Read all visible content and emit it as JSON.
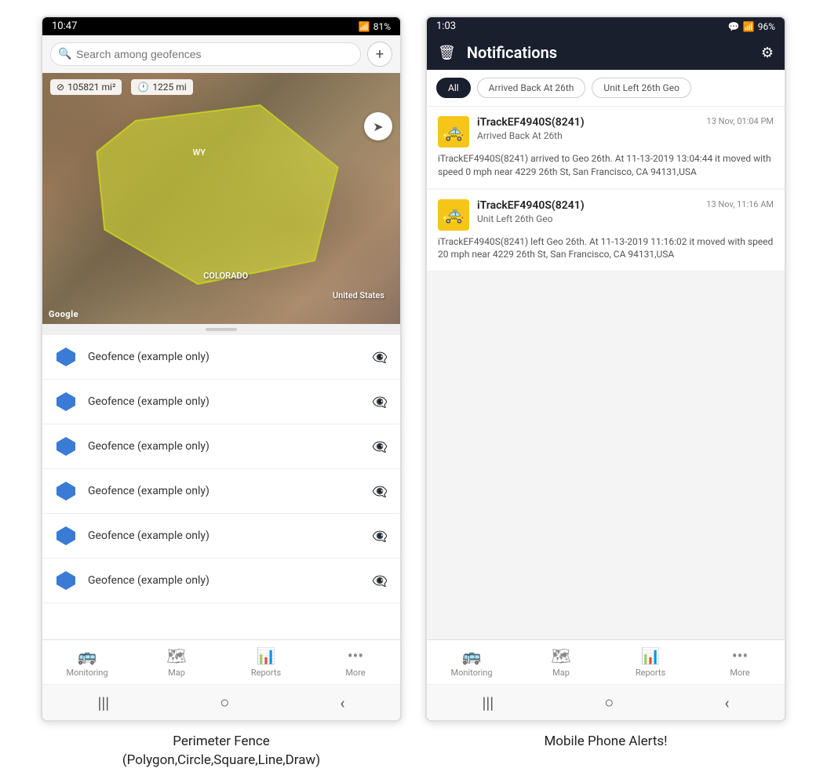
{
  "left_phone": {
    "status_bar": {
      "time": "10:47",
      "wifi": "📶",
      "signal": "📶",
      "battery": "81%"
    },
    "search_placeholder": "Search among geofences",
    "map": {
      "area_badge": "105821 mi²",
      "distance_badge": "1225 mi",
      "labels": {
        "wy": "WY",
        "colorado": "COLORADO",
        "united_states": "United States"
      },
      "google_label": "Google"
    },
    "geofences": [
      {
        "label": "Geofence (example only)"
      },
      {
        "label": "Geofence (example only)"
      },
      {
        "label": "Geofence (example only)"
      },
      {
        "label": "Geofence (example only)"
      },
      {
        "label": "Geofence (example only)"
      },
      {
        "label": "Geofence (example only)"
      }
    ],
    "bottom_nav": [
      {
        "label": "Monitoring",
        "icon": "🚌"
      },
      {
        "label": "Map",
        "icon": "🗺"
      },
      {
        "label": "Reports",
        "icon": "📊"
      },
      {
        "label": "More",
        "icon": "···"
      }
    ]
  },
  "right_phone": {
    "status_bar": {
      "time": "1:03",
      "chat_icon": "💬",
      "battery": "96%"
    },
    "header": {
      "title": "Notifications",
      "delete_icon": "🗑",
      "settings_icon": "⚙"
    },
    "filter_tabs": [
      {
        "label": "All",
        "active": true
      },
      {
        "label": "Arrived Back At 26th",
        "active": false
      },
      {
        "label": "Unit Left 26th Geo",
        "active": false
      }
    ],
    "notifications": [
      {
        "device": "iTrackEF4940S(8241)",
        "timestamp": "13 Nov, 01:04 PM",
        "subtitle": "Arrived Back At 26th",
        "description": "iTrackEF4940S(8241) arrived to Geo 26th.   At 11-13-2019 13:04:44 it moved with speed 0 mph near 4229 26th St, San Francisco, CA 94131,USA"
      },
      {
        "device": "iTrackEF4940S(8241)",
        "timestamp": "13 Nov, 11:16 AM",
        "subtitle": "Unit Left 26th Geo",
        "description": "iTrackEF4940S(8241) left Geo 26th.  At 11-13-2019 11:16:02 it moved with speed 20 mph near 4229 26th St, San Francisco, CA 94131,USA"
      }
    ],
    "bottom_nav": [
      {
        "label": "Monitoring",
        "icon": "🚌"
      },
      {
        "label": "Map",
        "icon": "🗺"
      },
      {
        "label": "Reports",
        "icon": "📊"
      },
      {
        "label": "More",
        "icon": "···"
      }
    ]
  },
  "captions": {
    "left": "Perimeter Fence\n(Polygon,Circle,Square,Line,Draw)",
    "right": "Mobile Phone Alerts!"
  }
}
